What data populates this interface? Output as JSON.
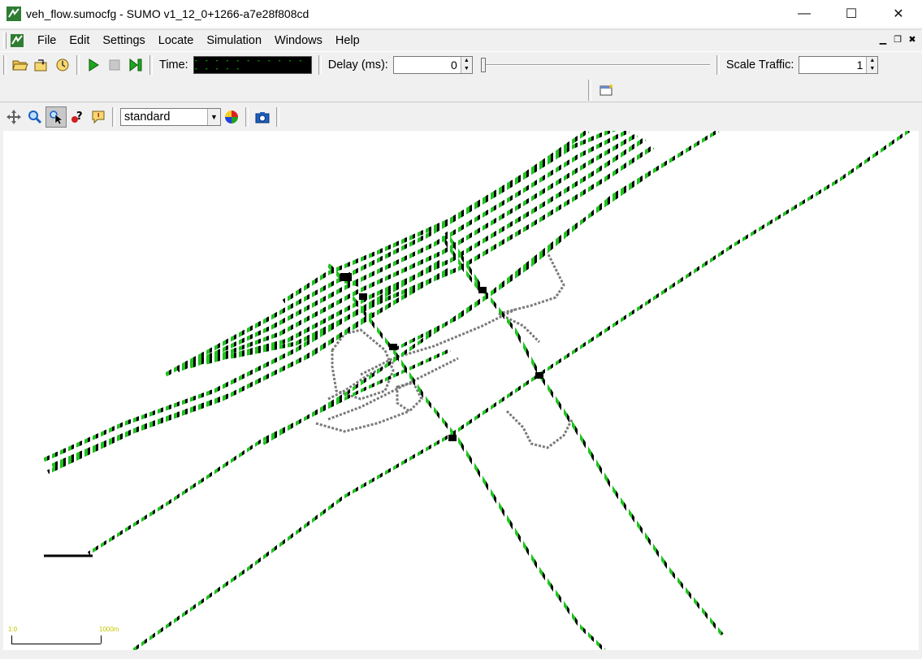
{
  "window": {
    "title": "veh_flow.sumocfg - SUMO v1_12_0+1266-a7e28f808cd",
    "minimize": "—",
    "maximize": "☐",
    "close": "✕"
  },
  "menu": {
    "items": [
      "File",
      "Edit",
      "Settings",
      "Locate",
      "Simulation",
      "Windows",
      "Help"
    ]
  },
  "toolbar": {
    "time_label": "Time:",
    "time_value": "- - - - - - - - - - - - - - - -",
    "delay_label": "Delay (ms):",
    "delay_value": "0",
    "scale_label": "Scale Traffic:",
    "scale_value": "1"
  },
  "view": {
    "scheme": "standard",
    "scale_left": "1:0",
    "scale_right": "1000m"
  },
  "colors": {
    "vehicle_green": "#1fc31f",
    "vehicle_black": "#000000",
    "road_gray": "#808080",
    "time_text": "#00ff00",
    "scale_text": "#c6c600"
  },
  "icons": {
    "app": "sumo-logo-icon",
    "open": "open-folder-icon",
    "reload": "reload-icon",
    "reopen": "recent-icon",
    "run": "play-icon",
    "stop": "stop-icon",
    "step": "step-icon",
    "new_view": "new-view-icon",
    "recenter": "recenter-icon",
    "locate": "magnifier-icon",
    "select": "select-cursor-icon",
    "inspect": "inspect-icon",
    "tooltips": "tooltip-icon",
    "scheme_edit": "color-wheel-icon",
    "screenshot": "camera-icon"
  }
}
